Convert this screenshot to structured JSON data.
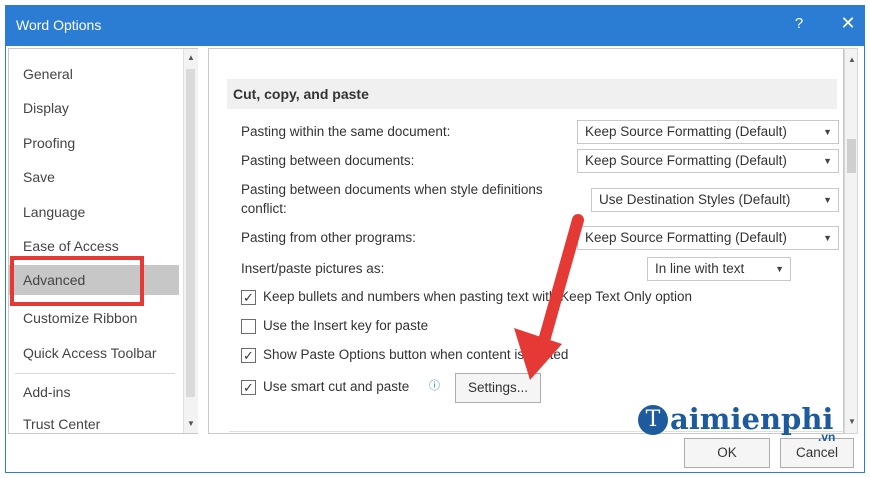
{
  "window": {
    "title": "Word Options",
    "help": "?",
    "close": "✕"
  },
  "sidebar": {
    "items": [
      {
        "label": "General"
      },
      {
        "label": "Display"
      },
      {
        "label": "Proofing"
      },
      {
        "label": "Save"
      },
      {
        "label": "Language"
      },
      {
        "label": "Ease of Access"
      },
      {
        "label": "Advanced"
      },
      {
        "label": "Customize Ribbon"
      },
      {
        "label": "Quick Access Toolbar"
      },
      {
        "label": "Add-ins"
      },
      {
        "label": "Trust Center"
      }
    ],
    "selected": "Advanced"
  },
  "section": {
    "title": "Cut, copy, and paste"
  },
  "paste_options": [
    {
      "label": "Pasting within the same document:",
      "value": "Keep Source Formatting (Default)"
    },
    {
      "label": "Pasting between documents:",
      "value": "Keep Source Formatting (Default)"
    },
    {
      "label": "Pasting between documents when style definitions conflict:",
      "label_line1": "Pasting between documents when style definitions",
      "label_line2": "conflict:",
      "value": "Use Destination Styles (Default)"
    },
    {
      "label": "Pasting from other programs:",
      "value": "Keep Source Formatting (Default)"
    },
    {
      "label": "Insert/paste pictures as:",
      "value": "In line with text"
    }
  ],
  "checkboxes": [
    {
      "label": "Keep bullets and numbers when pasting text with Keep Text Only option",
      "checked": true
    },
    {
      "label": "Use the Insert key for paste",
      "checked": false
    },
    {
      "label": "Show Paste Options button when content is pasted",
      "checked": true
    },
    {
      "label": "Use smart cut and paste",
      "checked": true
    }
  ],
  "check_mark": "✓",
  "dropdown_arrow": "▼",
  "info_icon": "ⓘ",
  "settings_button": "Settings...",
  "footer": {
    "ok": "OK",
    "cancel": "Cancel"
  },
  "watermark": {
    "text": "aimienphi",
    "logo_letter": "T",
    "tld": ".vn"
  },
  "colors": {
    "titlebar": "#2b7cd3",
    "selection": "#c7c7c7",
    "highlight": "#e53935",
    "arrow": "#e53935"
  }
}
